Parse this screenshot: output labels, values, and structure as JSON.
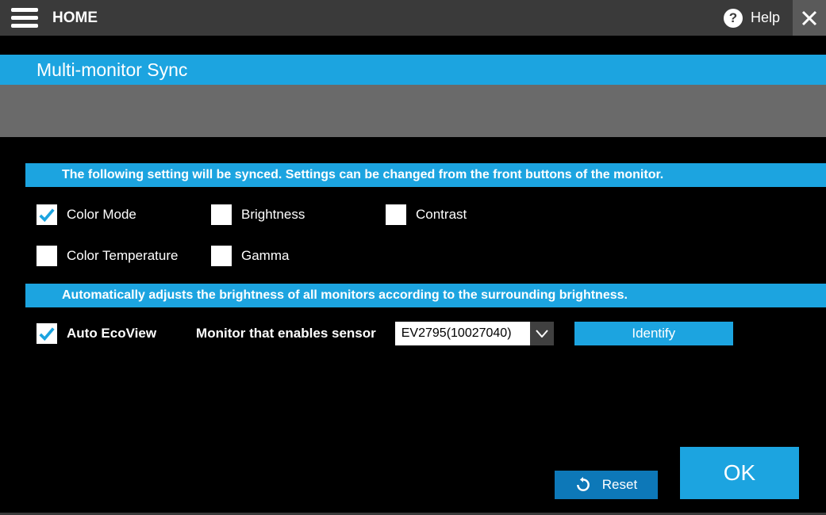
{
  "topbar": {
    "home": "HOME",
    "help": "Help"
  },
  "page": {
    "title": "Multi-monitor Sync"
  },
  "sync_section": {
    "header": "The following setting will be synced. Settings can be changed from the front buttons of the monitor.",
    "items": [
      {
        "label": "Color Mode",
        "checked": true
      },
      {
        "label": "Brightness",
        "checked": false
      },
      {
        "label": "Contrast",
        "checked": false
      },
      {
        "label": "Color Temperature",
        "checked": false
      },
      {
        "label": "Gamma",
        "checked": false
      }
    ]
  },
  "ecoview_section": {
    "header": "Automatically adjusts the brightness of all monitors according to the surrounding brightness.",
    "auto_label": "Auto EcoView",
    "auto_checked": true,
    "sensor_label": "Monitor that enables sensor",
    "sensor_value": "EV2795(10027040)",
    "identify": "Identify"
  },
  "footer": {
    "reset": "Reset",
    "ok": "OK"
  }
}
